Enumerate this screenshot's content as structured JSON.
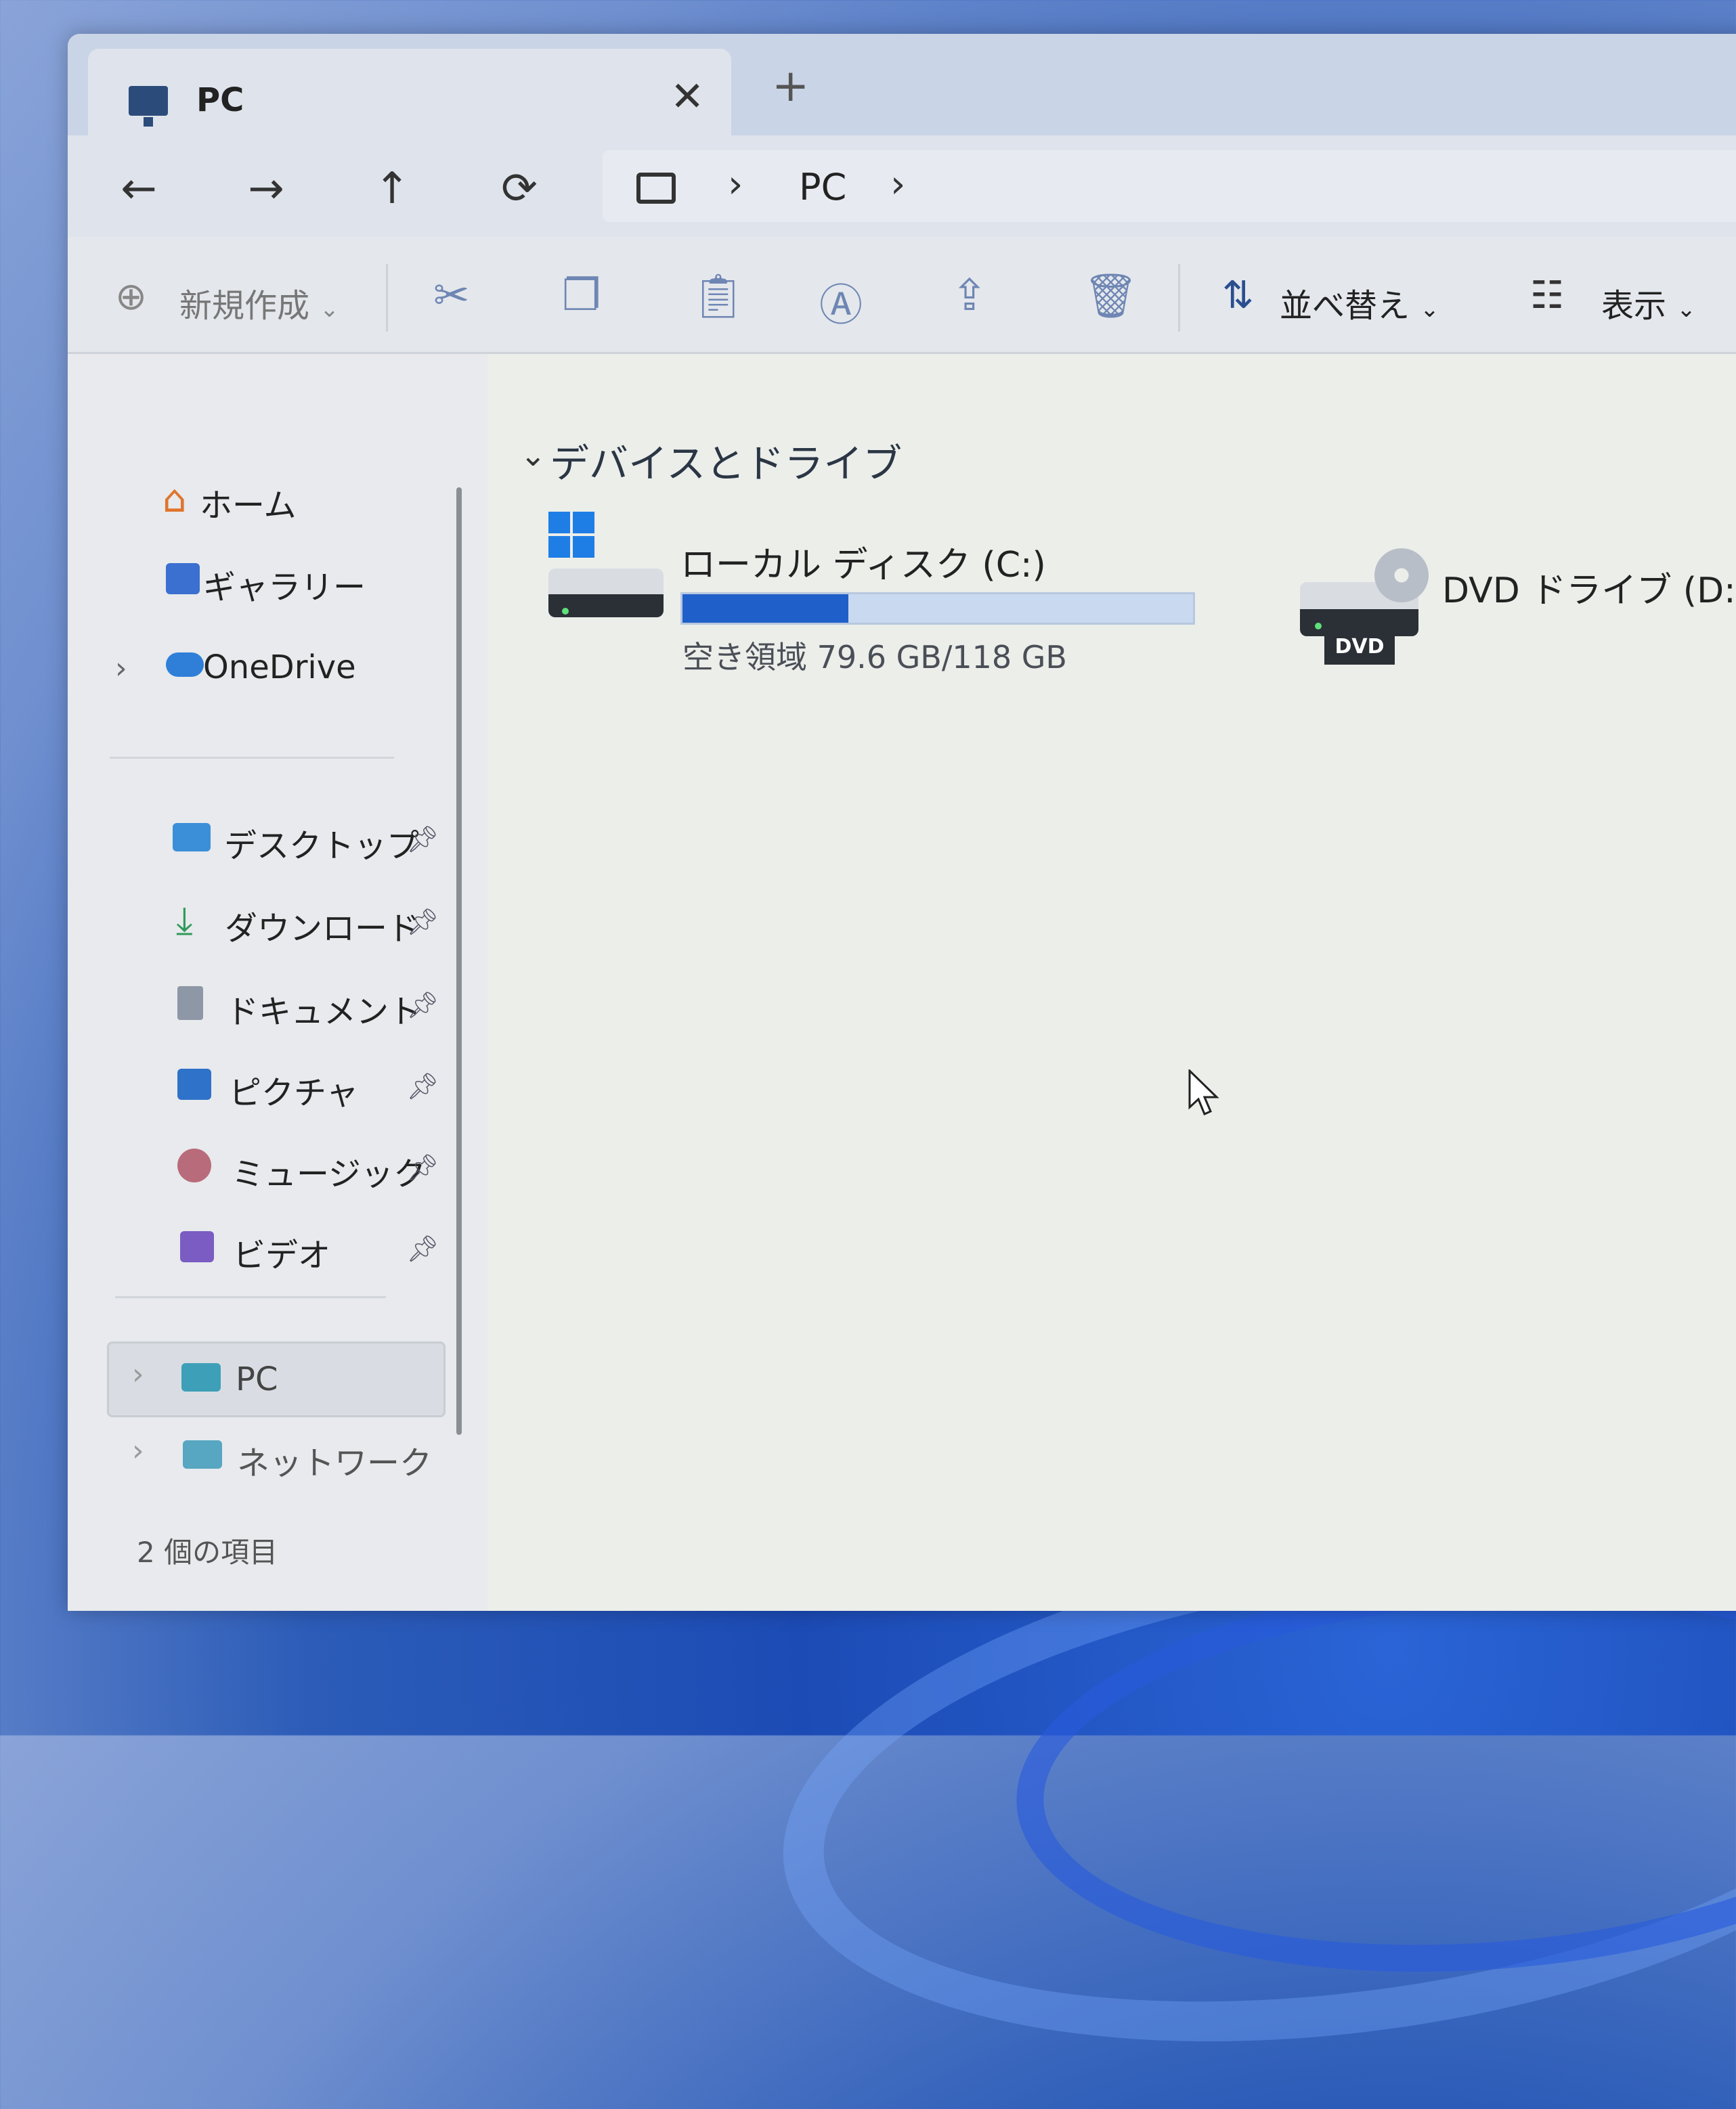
{
  "window": {
    "tab_title": "PC",
    "tab_close": "✕",
    "tab_add": "+"
  },
  "navigation": {
    "back": "←",
    "forward": "→",
    "up": "↑",
    "refresh": "⟳",
    "breadcrumb_sep": "›",
    "breadcrumb": [
      "PC"
    ]
  },
  "toolbar": {
    "new_label": "新規作成",
    "sort_label": "並べ替え",
    "view_label": "表示",
    "dropdown": "⌄"
  },
  "sidebar": {
    "items_top": [
      {
        "label": "ホーム",
        "icon": "home-icon"
      },
      {
        "label": "ギャラリー",
        "icon": "gallery-icon"
      },
      {
        "label": "OneDrive",
        "icon": "cloud-icon"
      }
    ],
    "quick_access": [
      {
        "label": "デスクトップ",
        "icon": "desktop-icon"
      },
      {
        "label": "ダウンロード",
        "icon": "download-icon"
      },
      {
        "label": "ドキュメント",
        "icon": "document-icon"
      },
      {
        "label": "ピクチャ",
        "icon": "picture-icon"
      },
      {
        "label": "ミュージック",
        "icon": "music-icon"
      },
      {
        "label": "ビデオ",
        "icon": "video-icon"
      }
    ],
    "items_bottom": [
      {
        "label": "PC",
        "icon": "pc-icon"
      },
      {
        "label": "ネットワーク",
        "icon": "network-icon"
      }
    ]
  },
  "content": {
    "group_title": "デバイスとドライブ",
    "drives": [
      {
        "name": "ローカル ディスク (C:)",
        "free_text": "空き領域 79.6 GB/118 GB",
        "used_fraction": 0.325
      },
      {
        "name": "DVD ドライブ (D:)",
        "badge": "DVD"
      }
    ]
  },
  "status": {
    "item_count": "2 個の項目"
  },
  "colors": {
    "accent": "#1f5fc9",
    "bar_bg": "#c9d9ef"
  }
}
